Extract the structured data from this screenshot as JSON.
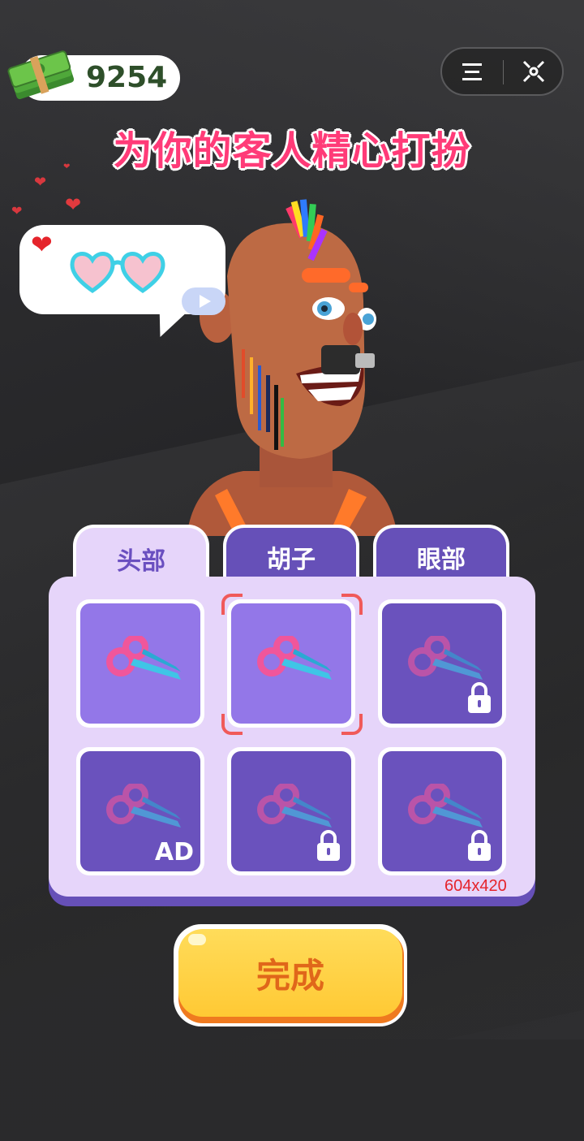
{
  "currency": {
    "icon": "cash-stack-icon",
    "value": "9254"
  },
  "top_controls": {
    "menu_icon": "menu-icon",
    "close_icon": "close-target-icon"
  },
  "title": "为你的客人精心打扮",
  "request_bubble": {
    "heart_icon": "heart-icon",
    "item_icon": "heart-sunglasses-icon",
    "play_icon": "play-icon"
  },
  "tabs": [
    {
      "label": "头部",
      "active": true
    },
    {
      "label": "胡子",
      "active": false
    },
    {
      "label": "眼部",
      "active": false
    }
  ],
  "items": [
    {
      "icon": "scissors-icon",
      "state": "available",
      "selected": false
    },
    {
      "icon": "scissors-icon",
      "state": "available",
      "selected": true
    },
    {
      "icon": "scissors-icon",
      "state": "locked"
    },
    {
      "icon": "scissors-icon",
      "state": "ad",
      "badge": "AD"
    },
    {
      "icon": "scissors-icon",
      "state": "locked"
    },
    {
      "icon": "scissors-icon",
      "state": "locked"
    }
  ],
  "panel_size_label": "604x420",
  "done_button": "完成",
  "colors": {
    "title": "#ff3b78",
    "panel": "#e6d5fa",
    "tab_inactive": "#6650b8",
    "done_button": "#ffd245",
    "done_text": "#e0671a"
  }
}
